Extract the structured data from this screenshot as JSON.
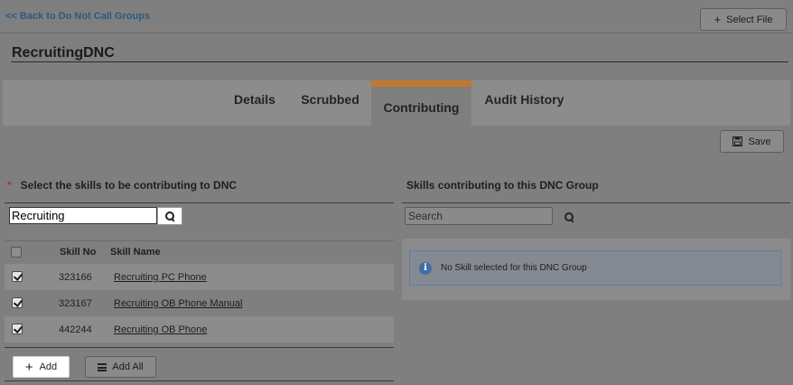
{
  "nav": {
    "back_label": "<< Back to Do Not Call Groups"
  },
  "toolbar": {
    "select_file_label": "Select File",
    "save_label": "Save"
  },
  "page": {
    "title": "RecruitingDNC"
  },
  "tabs": [
    {
      "label": "Details",
      "active": false
    },
    {
      "label": "Scrubbed",
      "active": false
    },
    {
      "label": "Contributing",
      "active": true
    },
    {
      "label": "Audit History",
      "active": false
    }
  ],
  "left_panel": {
    "required_marker": "*",
    "heading": "Select the skills to be contributing to DNC",
    "search_value": "Recruiting",
    "columns": {
      "skill_no": "Skill No",
      "skill_name": "Skill Name"
    },
    "rows": [
      {
        "checked": true,
        "skill_no": "323166",
        "skill_name": "Recruiting PC Phone"
      },
      {
        "checked": true,
        "skill_no": "323167",
        "skill_name": "Recruiting OB Phone Manual"
      },
      {
        "checked": true,
        "skill_no": "442244",
        "skill_name": "Recruiting OB Phone"
      }
    ],
    "add_label": "Add",
    "add_all_label": "Add All"
  },
  "right_panel": {
    "heading": "Skills contributing to this DNC Group",
    "search_placeholder": "Search",
    "empty_message": "No Skill selected for this DNC Group"
  },
  "icons": {
    "select_file": "plus-icon",
    "save": "save-icon",
    "search": "search-icon",
    "add": "plus-icon",
    "add_all": "list-icon",
    "info": "info-icon"
  },
  "colors": {
    "link": "#2b5a84",
    "active_tab_accent": "#c07830",
    "info_border": "#5a7eab",
    "required": "#b03030"
  }
}
